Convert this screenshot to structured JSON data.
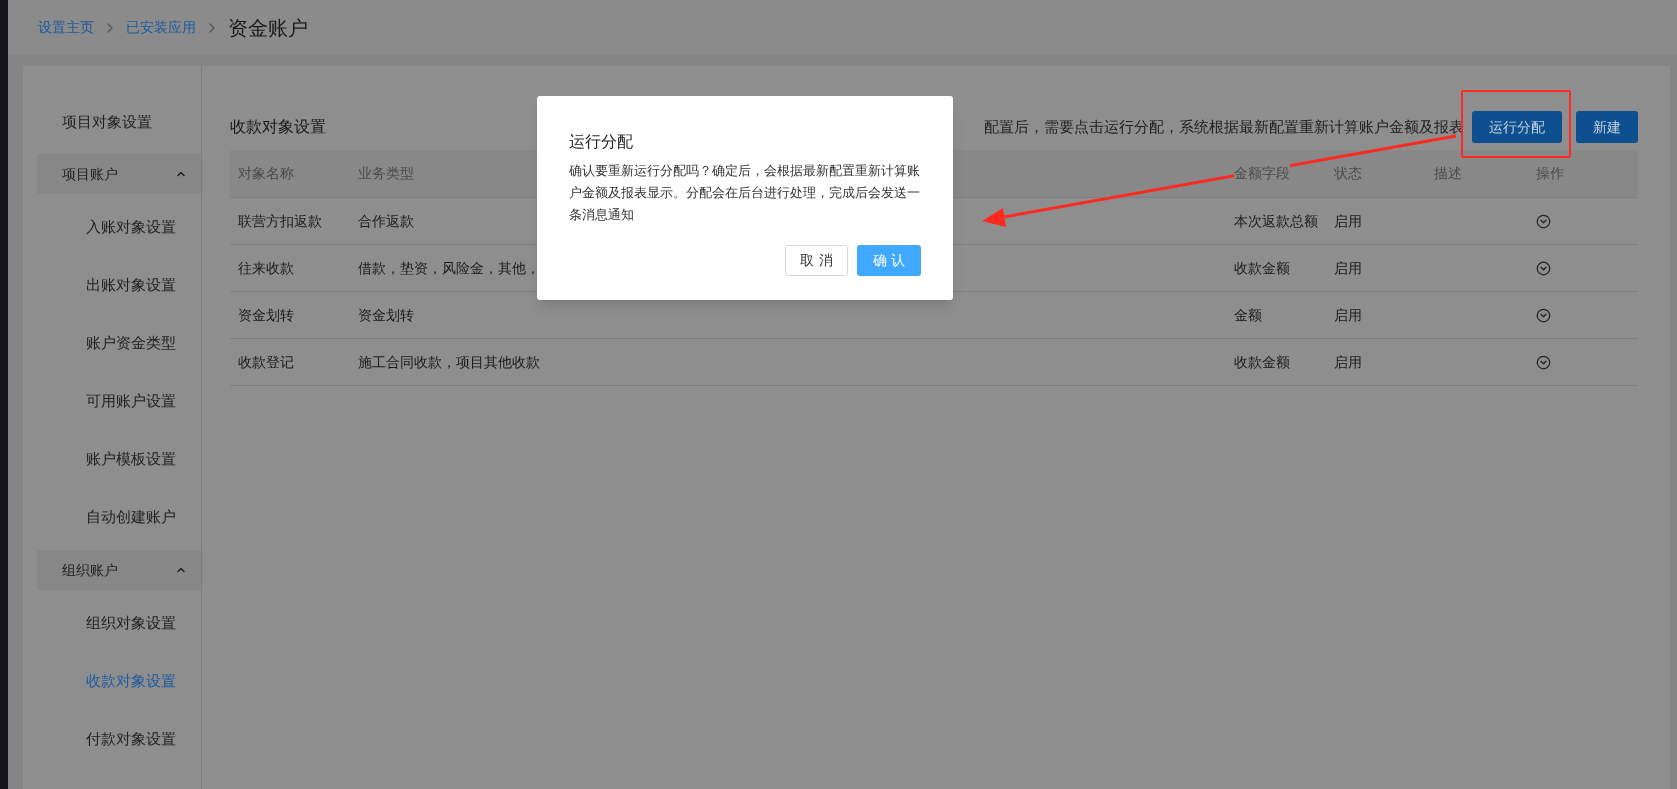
{
  "breadcrumb": [
    {
      "label": "设置主页",
      "kind": "link"
    },
    {
      "label": "已安装应用",
      "kind": "link"
    },
    {
      "label": "资金账户",
      "kind": "current"
    }
  ],
  "sidebar": {
    "items": [
      {
        "label": "项目对象设置",
        "kind": "item",
        "selected": false
      },
      {
        "label": "项目账户",
        "kind": "group",
        "expanded": true,
        "children": [
          {
            "label": "入账对象设置",
            "selected": false
          },
          {
            "label": "出账对象设置",
            "selected": false
          },
          {
            "label": "账户资金类型",
            "selected": false
          },
          {
            "label": "可用账户设置",
            "selected": false
          },
          {
            "label": "账户模板设置",
            "selected": false
          },
          {
            "label": "自动创建账户",
            "selected": false
          }
        ]
      },
      {
        "label": "组织账户",
        "kind": "group",
        "expanded": true,
        "children": [
          {
            "label": "组织对象设置",
            "selected": false
          },
          {
            "label": "收款对象设置",
            "selected": true
          },
          {
            "label": "付款对象设置",
            "selected": false
          }
        ]
      }
    ]
  },
  "page_title": "收款对象设置",
  "notice": "配置后，需要点击运行分配，系统根据最新配置重新计算账户金额及报表",
  "toolbar": {
    "buttons": [
      {
        "label": "运行分配",
        "highlighted": true
      },
      {
        "label": "新建",
        "highlighted": false
      }
    ]
  },
  "table": {
    "columns": [
      "对象名称",
      "业务类型",
      "金额字段",
      "状态",
      "描述",
      "操作"
    ],
    "rows": [
      {
        "name": "联营方扣返款",
        "business_type": "合作返款",
        "amount_field": "本次返款总额",
        "status": "启用"
      },
      {
        "name": "往来收款",
        "business_type": "借款，垫资，风险金，其他，",
        "amount_field": "收款金额",
        "status": "启用"
      },
      {
        "name": "资金划转",
        "business_type": "资金划转",
        "amount_field": "金额",
        "status": "启用"
      },
      {
        "name": "收款登记",
        "business_type": "施工合同收款，项目其他收款",
        "amount_field": "收款金额",
        "status": "启用"
      }
    ]
  },
  "dialog": {
    "title": "运行分配",
    "message": "确认要重新运行分配吗？确定后，会根据最新配置重新计算账户金额及报表显示。分配会在后台进行处理，完成后会发送一条消息通知",
    "buttons": [
      {
        "label": "取 消",
        "kind": "secondary"
      },
      {
        "label": "确 认",
        "kind": "primary"
      }
    ]
  }
}
